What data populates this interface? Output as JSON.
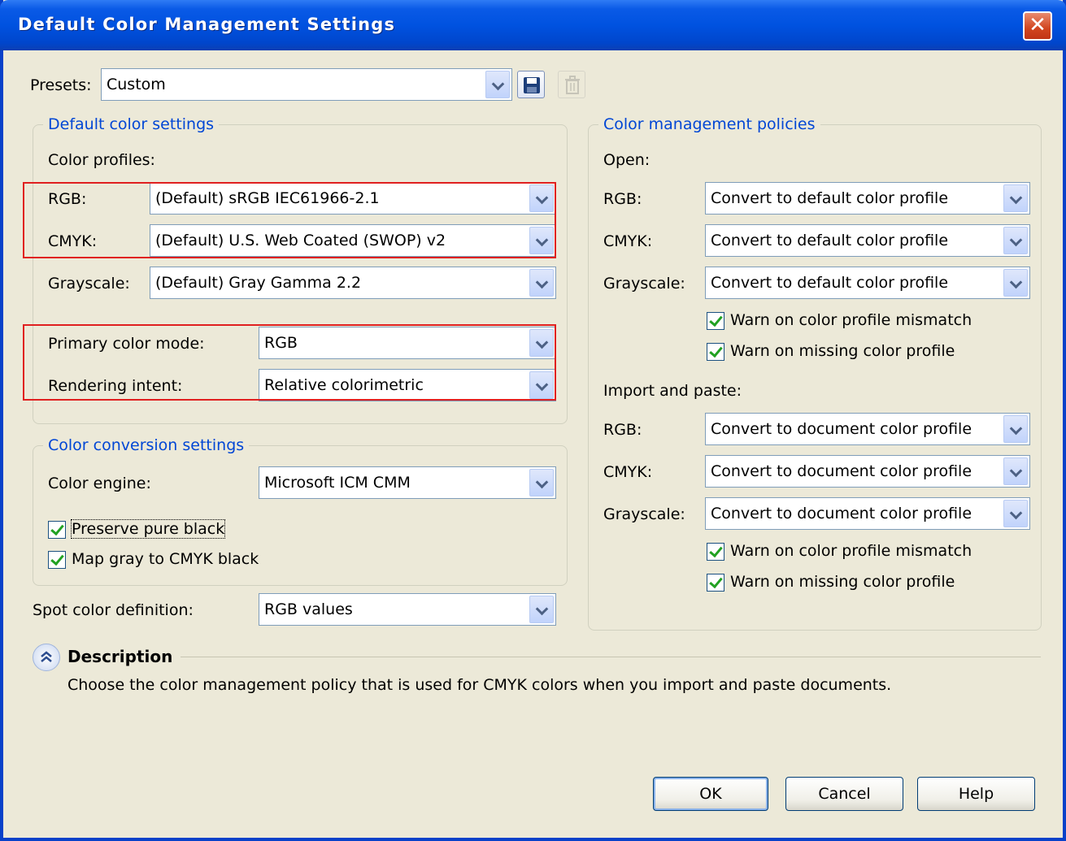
{
  "window": {
    "title": "Default Color Management Settings",
    "close_glyph": "✕"
  },
  "presets": {
    "label": "Presets:",
    "value": "Custom",
    "save_icon": "save-icon",
    "delete_icon": "delete-icon"
  },
  "default_color_settings": {
    "legend": "Default color settings",
    "profiles_label": "Color profiles:",
    "rgb": {
      "label": "RGB:",
      "value": "(Default) sRGB IEC61966-2.1"
    },
    "cmyk": {
      "label": "CMYK:",
      "value": "(Default) U.S. Web Coated (SWOP) v2"
    },
    "grayscale": {
      "label": "Grayscale:",
      "value": "(Default) Gray Gamma 2.2"
    },
    "primary_mode": {
      "label": "Primary color mode:",
      "value": "RGB"
    },
    "rendering_intent": {
      "label": "Rendering intent:",
      "value": "Relative colorimetric"
    }
  },
  "conversion_settings": {
    "legend": "Color conversion settings",
    "engine": {
      "label": "Color engine:",
      "value": "Microsoft ICM CMM"
    },
    "preserve_black": {
      "label": "Preserve pure black",
      "checked": true
    },
    "map_gray": {
      "label": "Map gray to CMYK black",
      "checked": true
    }
  },
  "spot_color": {
    "label": "Spot color definition:",
    "value": "RGB values"
  },
  "policies": {
    "legend": "Color management policies",
    "open": {
      "heading": "Open:",
      "rgb": {
        "label": "RGB:",
        "value": "Convert to default color profile"
      },
      "cmyk": {
        "label": "CMYK:",
        "value": "Convert to default color profile"
      },
      "grayscale": {
        "label": "Grayscale:",
        "value": "Convert to default color profile"
      },
      "warn_mismatch": "Warn on color profile mismatch",
      "warn_missing": "Warn on missing color profile"
    },
    "import": {
      "heading": "Import and paste:",
      "rgb": {
        "label": "RGB:",
        "value": "Convert to document color profile"
      },
      "cmyk": {
        "label": "CMYK:",
        "value": "Convert to document color profile"
      },
      "grayscale": {
        "label": "Grayscale:",
        "value": "Convert to document color profile"
      },
      "warn_mismatch": "Warn on color profile mismatch",
      "warn_missing": "Warn on missing color profile"
    }
  },
  "description": {
    "heading": "Description",
    "text": "Choose the color management policy that is used for CMYK colors when you import and paste documents."
  },
  "buttons": {
    "ok": "OK",
    "cancel": "Cancel",
    "help": "Help"
  },
  "colors": {
    "title_bar": "#0052e0",
    "legend_text": "#0046d5",
    "highlight_box": "#e02020",
    "dialog_bg": "#ece9d8"
  }
}
